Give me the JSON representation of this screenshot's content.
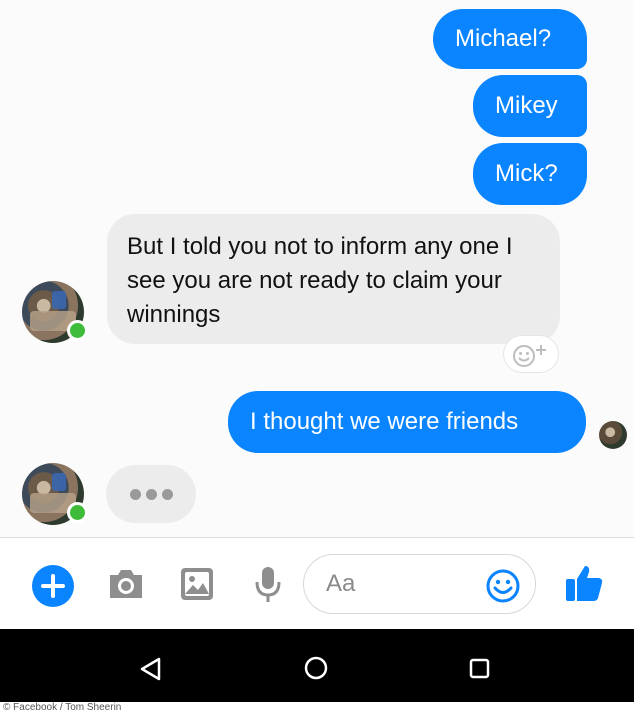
{
  "messages": {
    "sent_1": "Michael?",
    "sent_2": "Mikey",
    "sent_3": "Mick?",
    "received_1": "But I told you not to inform any one I see you are not ready to claim your winnings",
    "sent_4": "I thought we were friends"
  },
  "composer": {
    "placeholder": "Aa",
    "icons": [
      "plus-icon",
      "camera-icon",
      "image-icon",
      "mic-icon",
      "emoji-icon",
      "thumbs-up-icon"
    ]
  },
  "navbar": {
    "icons": [
      "back-icon",
      "home-icon",
      "recents-icon"
    ]
  },
  "credit": "© Facebook / Tom Sheerin",
  "colors": {
    "accent": "#0a84ff",
    "incoming_bubble": "#ececec",
    "online": "#3fbb3a"
  }
}
